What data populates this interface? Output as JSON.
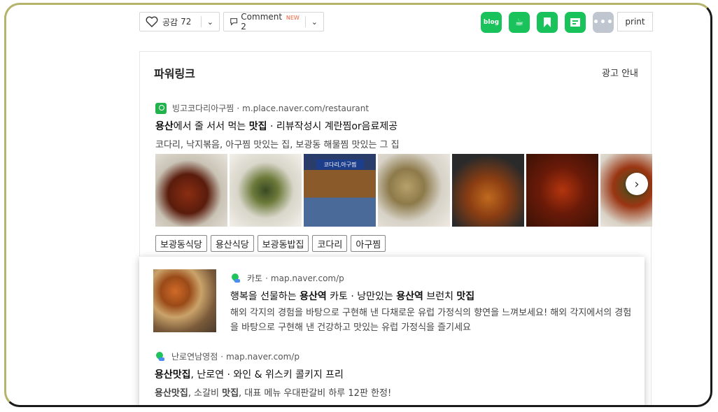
{
  "toolbar": {
    "like_label": "공감",
    "like_count": "72",
    "comment_label": "Comment 2",
    "new_badge": "NEW",
    "share_buttons": [
      {
        "name": "blog",
        "label": "blog",
        "color": "#19c25a"
      },
      {
        "name": "cafe",
        "label": "☕",
        "color": "#19c25a"
      },
      {
        "name": "bookmark",
        "label": "",
        "color": "#19c25a"
      },
      {
        "name": "memo",
        "label": "",
        "color": "#19c25a"
      }
    ],
    "more_label": "•••",
    "print_label": "print"
  },
  "powerlink": {
    "title": "파워링크",
    "ad_info": "광고 안내",
    "ad1": {
      "site_name": "빙고코다리아구찜",
      "site_url": "m.place.naver.com/restaurant",
      "headline_parts": [
        "용산",
        "에서 줄 서서 먹는 ",
        "맛집",
        " · 리뷰작성시 계란찜or음료제공"
      ],
      "description": "코다리, 낙지볶음, 아구찜 맛있는 집, 보광동 해물찜 맛있는 그 집",
      "sign_text": "코다리,아구찜",
      "tags": [
        "보광동식당",
        "용산식당",
        "보광동밥집",
        "코다리",
        "아구찜"
      ]
    }
  },
  "card": {
    "ad2": {
      "site_name": "카토",
      "site_url": "map.naver.com/p",
      "headline_parts": [
        "행복을 선물하는 ",
        "용산역",
        " 카토 · 낭만있는 ",
        "용산역",
        " 브런치 ",
        "맛집"
      ],
      "description": "해외 각지의 경험을 바탕으로 구현해 낸 다채로운 유럽 가정식의 향연을 느껴보세요! 해외 각지에서의 경험을 바탕으로 구현해 낸 건강하고 맛있는 유럽 가정식을 즐기세요"
    },
    "ad3": {
      "site_name": "난로연남영점",
      "site_url": "map.naver.com/p",
      "headline_parts": [
        "용산맛집",
        ", 난로연 · 와인 & 위스키 콜키지 프리"
      ],
      "description_parts": [
        "용산맛집",
        ", 소갈비 ",
        "맛집",
        ", 대표 메뉴 우대판갈비 하루 12판 한정!"
      ]
    }
  },
  "colors": {
    "accent_green": "#19c25a",
    "frame_border": "#b5b46a",
    "new_badge": "#f25f3a"
  }
}
